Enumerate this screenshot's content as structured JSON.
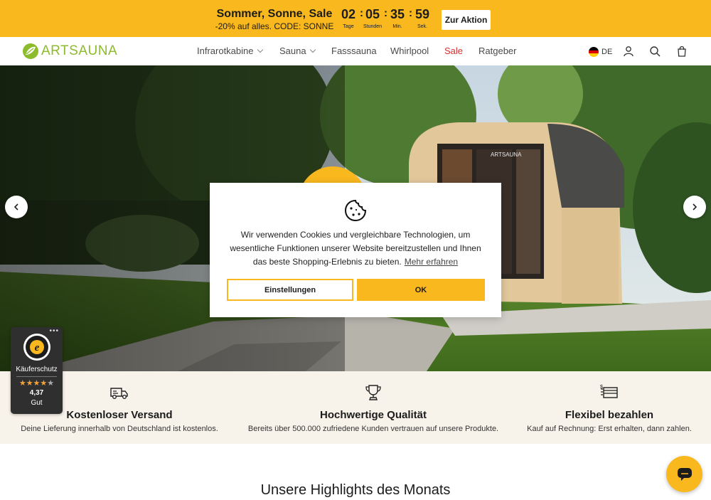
{
  "promo": {
    "title": "Sommer, Sonne, Sale",
    "subtitle": "-20% auf alles. CODE: SONNE",
    "countdown": [
      {
        "value": "02",
        "label": "Tage"
      },
      {
        "value": "05",
        "label": "Stunden"
      },
      {
        "value": "35",
        "label": "Min."
      },
      {
        "value": "59",
        "label": "Sek."
      }
    ],
    "separator": ":",
    "button": "Zur Aktion",
    "bg_color": "#f9b81e"
  },
  "header": {
    "logo_text": "ARTSAUNA",
    "nav": [
      {
        "label": "Infrarotkabine",
        "dropdown": true
      },
      {
        "label": "Sauna",
        "dropdown": true
      },
      {
        "label": "Fasssauna"
      },
      {
        "label": "Whirlpool"
      },
      {
        "label": "Sale",
        "color": "#d2302f"
      },
      {
        "label": "Ratgeber"
      }
    ],
    "language": "DE",
    "icons": [
      "user-icon",
      "search-icon",
      "cart-icon"
    ]
  },
  "hero": {
    "sauna_brand_text": "ARTSAUNA"
  },
  "cookie": {
    "text": "Wir verwenden Cookies und vergleichbare Technologien, um wesentliche Funktionen unserer Website bereitzustellen und Ihnen das beste Shopping-Erlebnis zu bieten.",
    "link": "Mehr erfahren",
    "settings_button": "Einstellungen",
    "ok_button": "OK"
  },
  "features": [
    {
      "icon": "truck-icon",
      "title": "Kostenloser Versand",
      "desc": "Deine Lieferung innerhalb von Deutschland ist kostenlos."
    },
    {
      "icon": "trophy-icon",
      "title": "Hochwertige Qualität",
      "desc": "Bereits über 500.000 zufriedene Kunden vertrauen auf unsere Produkte."
    },
    {
      "icon": "payment-icon",
      "title": "Flexibel bezahlen",
      "desc": "Kauf auf Rechnung: Erst erhalten, dann zahlen."
    }
  ],
  "trust": {
    "label": "Käuferschutz",
    "score": "4,37",
    "word": "Gut",
    "stars": "★★★★",
    "star_dim": "★",
    "menu": "•••"
  },
  "highlights_title": "Unsere Highlights des Monats"
}
